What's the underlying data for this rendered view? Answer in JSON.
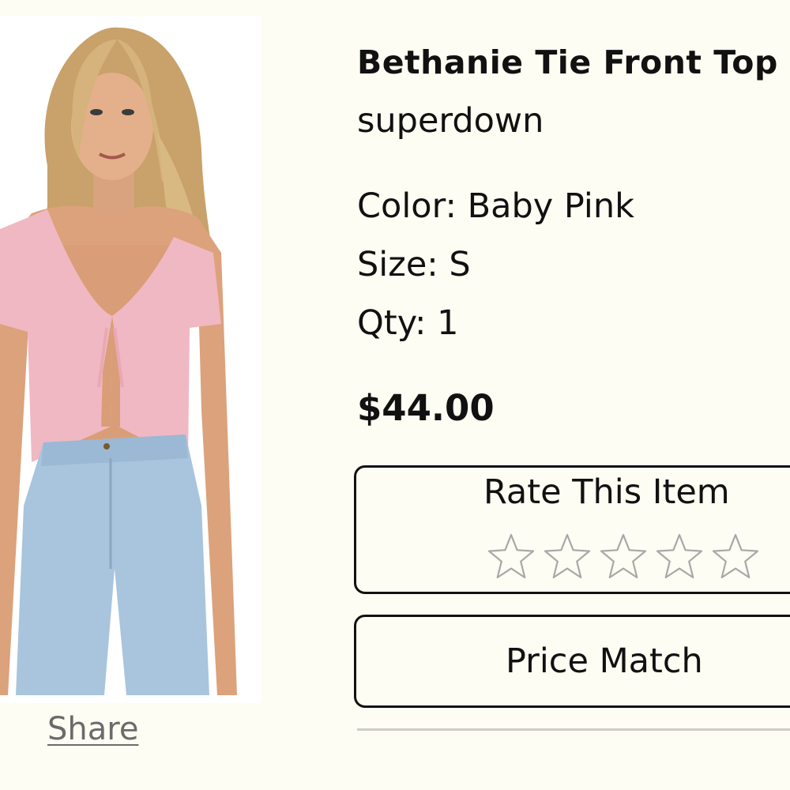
{
  "product": {
    "title": "Bethanie Tie Front Top",
    "brand": "superdown",
    "color_line": "Color: Baby Pink",
    "size_line": "Size: S",
    "qty_line": "Qty: 1",
    "price": "$44.00",
    "image_icon": "product-photo"
  },
  "rating": {
    "title": "Rate This Item",
    "max_stars": 5,
    "current_stars": 0,
    "star_color": "#a8a8a8"
  },
  "actions": {
    "price_match_label": "Price Match",
    "share_label": "Share"
  },
  "colors": {
    "background": "#fefdf3",
    "text": "#111111",
    "share_text": "#6b6b6b",
    "divider": "#cfcdc6"
  }
}
